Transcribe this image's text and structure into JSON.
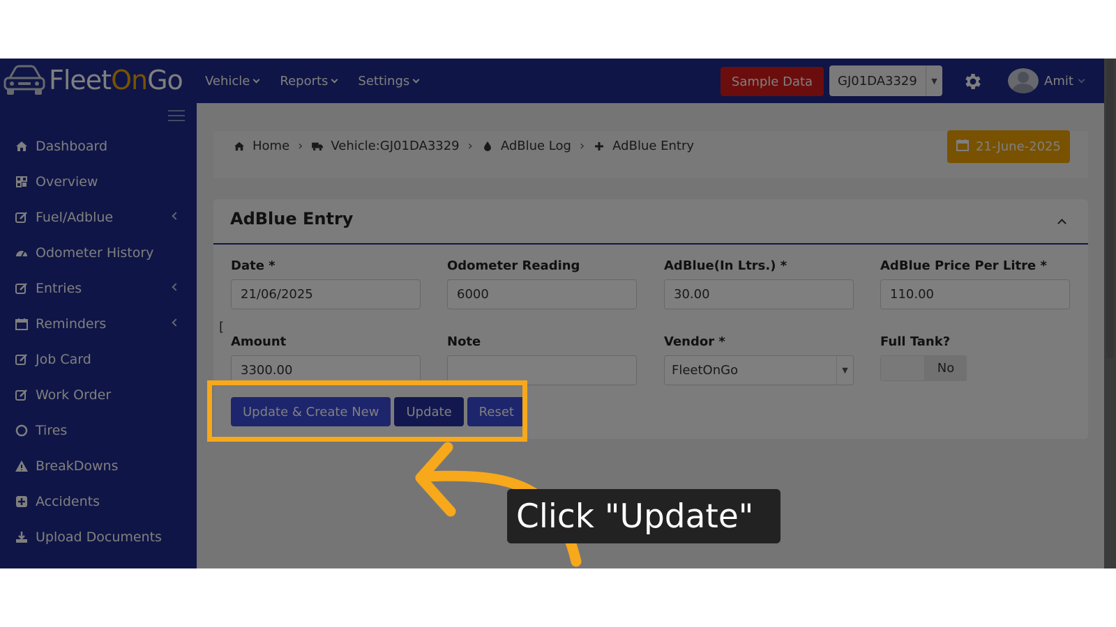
{
  "app": {
    "logo_prefix": "Fleet",
    "logo_on": "On",
    "logo_suffix": "Go"
  },
  "topnav": {
    "items": [
      {
        "label": "Vehicle"
      },
      {
        "label": "Reports"
      },
      {
        "label": "Settings"
      }
    ],
    "sample_data_label": "Sample Data",
    "vehicle_select_value": "GJ01DA3329",
    "user_name": "Amit"
  },
  "sidebar": {
    "items": [
      {
        "label": "Dashboard",
        "icon": "home-icon"
      },
      {
        "label": "Overview",
        "icon": "grid-icon"
      },
      {
        "label": "Fuel/Adblue",
        "icon": "edit-icon",
        "has_submenu": true
      },
      {
        "label": "Odometer History",
        "icon": "dashboard-gauge-icon"
      },
      {
        "label": "Entries",
        "icon": "edit-icon",
        "has_submenu": true
      },
      {
        "label": "Reminders",
        "icon": "calendar-icon",
        "has_submenu": true
      },
      {
        "label": "Job Card",
        "icon": "edit-icon"
      },
      {
        "label": "Work Order",
        "icon": "edit-icon"
      },
      {
        "label": "Tires",
        "icon": "circle-icon"
      },
      {
        "label": "BreakDowns",
        "icon": "warning-icon"
      },
      {
        "label": "Accidents",
        "icon": "plus-square-icon"
      },
      {
        "label": "Upload Documents",
        "icon": "download-icon"
      }
    ]
  },
  "breadcrumb": {
    "home": "Home",
    "vehicle": "Vehicle:GJ01DA3329",
    "log": "AdBlue Log",
    "current": "AdBlue Entry"
  },
  "date_button": "21-June-2025",
  "form": {
    "title": "AdBlue Entry",
    "date": {
      "label": "Date *",
      "value": "21/06/2025"
    },
    "odometer": {
      "label": "Odometer Reading",
      "value": "6000"
    },
    "adblue": {
      "label": "AdBlue(In Ltrs.) *",
      "value": "30.00"
    },
    "price": {
      "label": "AdBlue Price Per Litre *",
      "value": "110.00"
    },
    "amount": {
      "label": "Amount",
      "value": "3300.00"
    },
    "note": {
      "label": "Note",
      "value": ""
    },
    "vendor": {
      "label": "Vendor *",
      "value": "FleetOnGo"
    },
    "full_tank": {
      "label": "Full Tank?",
      "value": "No"
    },
    "stray_char": "[",
    "buttons": {
      "update_create_new": "Update & Create New",
      "update": "Update",
      "reset": "Reset"
    }
  },
  "tutorial": {
    "callout_text": "Click \"Update\"",
    "highlight_color": "#f7a81b"
  },
  "colors": {
    "brand_navy": "#1e2a8c",
    "accent_orange": "#f2a500",
    "sample_red": "#d91a1a",
    "button_blue": "#3a4bd8"
  }
}
